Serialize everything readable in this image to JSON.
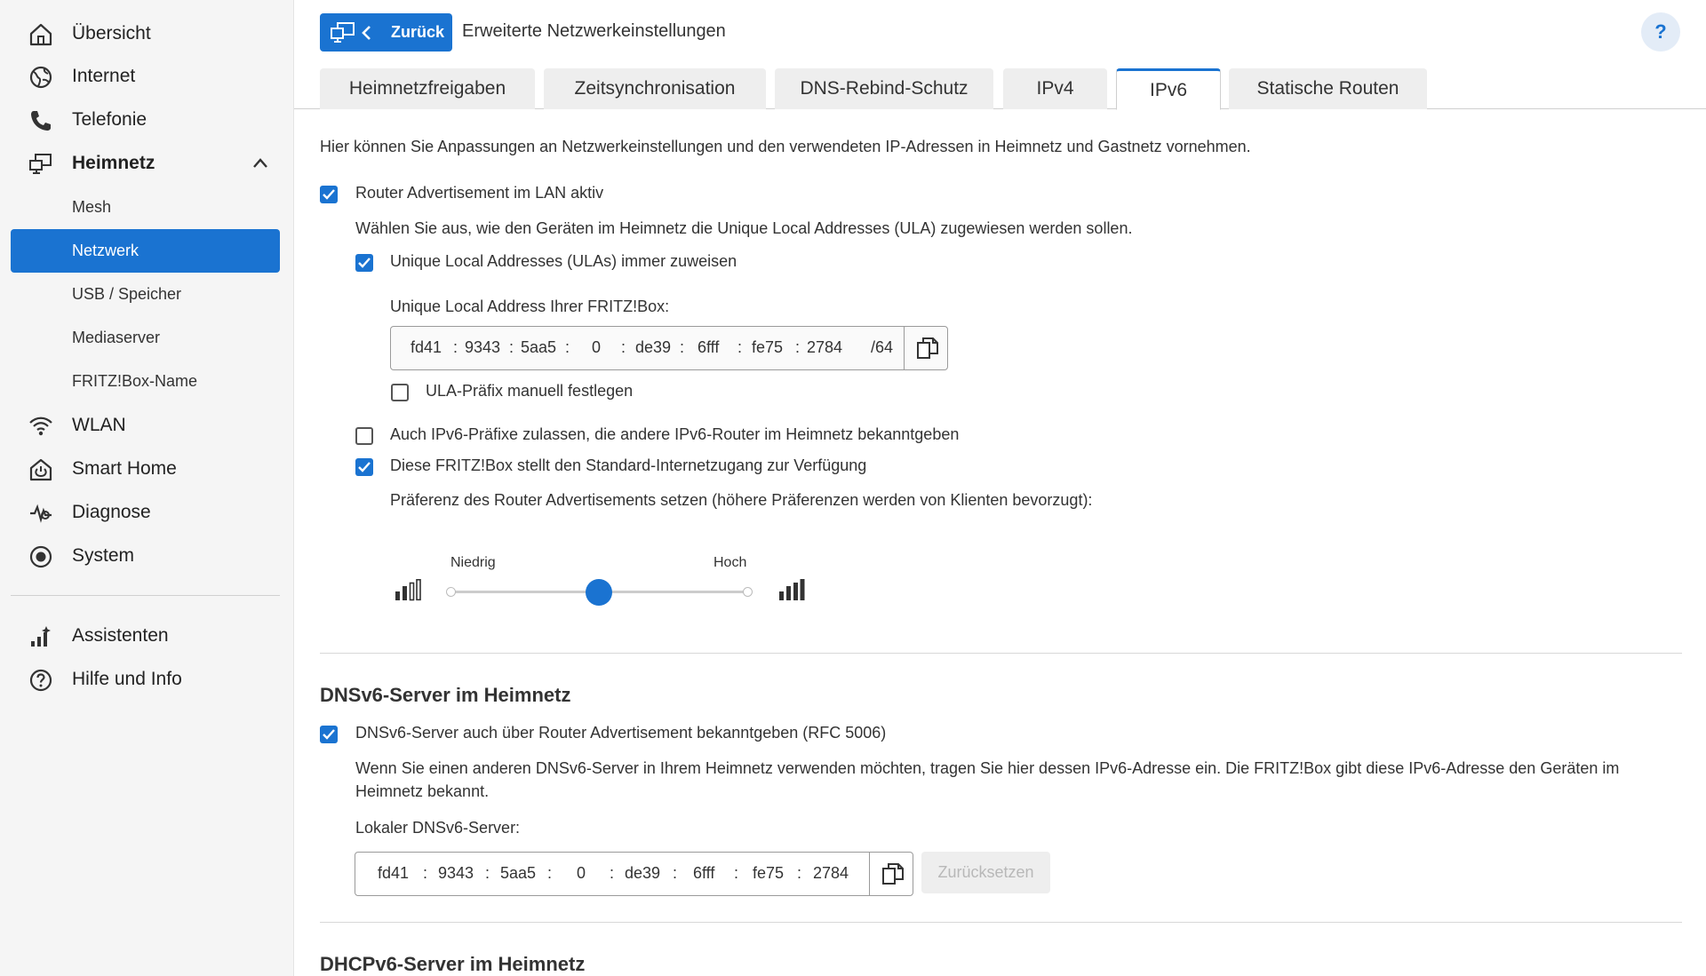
{
  "sidebar": {
    "items": [
      {
        "label": "Übersicht",
        "icon": "home-icon"
      },
      {
        "label": "Internet",
        "icon": "globe-icon"
      },
      {
        "label": "Telefonie",
        "icon": "phone-icon"
      },
      {
        "label": "Heimnetz",
        "icon": "network-icon",
        "expanded": true
      },
      {
        "label": "WLAN",
        "icon": "wifi-icon"
      },
      {
        "label": "Smart Home",
        "icon": "smart-home-icon"
      },
      {
        "label": "Diagnose",
        "icon": "diagnose-icon"
      },
      {
        "label": "System",
        "icon": "system-icon"
      },
      {
        "label": "Assistenten",
        "icon": "assistant-icon"
      },
      {
        "label": "Hilfe und Info",
        "icon": "help-circle-icon"
      }
    ],
    "subitems": [
      {
        "label": "Mesh"
      },
      {
        "label": "Netzwerk",
        "active": true
      },
      {
        "label": "USB / Speicher"
      },
      {
        "label": "Mediaserver"
      },
      {
        "label": "FRITZ!Box-Name"
      }
    ]
  },
  "header": {
    "back_label": "Zurück",
    "title": "Erweiterte Netzwerkeinstellungen",
    "help_label": "?"
  },
  "tabs": [
    {
      "label": "Heimnetzfreigaben"
    },
    {
      "label": "Zeitsynchronisation"
    },
    {
      "label": "DNS-Rebind-Schutz"
    },
    {
      "label": "IPv4"
    },
    {
      "label": "IPv6",
      "active": true
    },
    {
      "label": "Statische Routen"
    }
  ],
  "content": {
    "intro": "Hier können Sie Anpassungen an Netzwerkeinstellungen und den verwendeten IP-Adressen in Heimnetz und Gastnetz vornehmen.",
    "ra_lan": {
      "label": "Router Advertisement im LAN aktiv",
      "checked": true
    },
    "ula_desc": "Wählen Sie aus, wie den Geräten im Heimnetz die Unique Local Addresses (ULA) zugewiesen werden sollen.",
    "ula_always": {
      "label": "Unique Local Addresses (ULAs) immer zuweisen",
      "checked": true
    },
    "ula_addr_label": "Unique Local Address Ihrer FRITZ!Box:",
    "ula_addr": [
      "fd41",
      "9343",
      "5aa5",
      "0",
      "de39",
      "6fff",
      "fe75",
      "2784"
    ],
    "ula_prefix": "/64",
    "ula_manual": {
      "label": "ULA-Präfix manuell festlegen",
      "checked": false
    },
    "other_prefix": {
      "label": "Auch IPv6-Präfixe zulassen, die andere IPv6-Router im Heimnetz bekanntgeben",
      "checked": false
    },
    "std_access": {
      "label": "Diese FRITZ!Box stellt den Standard-Internetzugang zur Verfügung",
      "checked": true
    },
    "pref_label": "Präferenz des Router Advertisements setzen (höhere Präferenzen werden von Klienten bevorzugt):",
    "slider": {
      "low": "Niedrig",
      "high": "Hoch",
      "value": "medium"
    },
    "dns_title": "DNSv6-Server im Heimnetz",
    "dns_ra": {
      "label": "DNSv6-Server auch über Router Advertisement bekanntgeben (RFC 5006)",
      "checked": true
    },
    "dns_desc_1": "Wenn Sie einen anderen DNSv6-Server in Ihrem Heimnetz verwenden möchten, tragen Sie hier dessen IPv6-Adresse ein. Die FRITZ!Box gibt diese IPv6-Adresse den Geräten im",
    "dns_desc_2": "Heimnetz bekannt.",
    "dns_local_label": "Lokaler DNSv6-Server:",
    "dns_addr": [
      "fd41",
      "9343",
      "5aa5",
      "0",
      "de39",
      "6fff",
      "fe75",
      "2784"
    ],
    "reset_label": "Zurücksetzen",
    "dhcp_title": "DHCPv6-Server im Heimnetz"
  },
  "colors": {
    "accent": "#1a73d1",
    "sidebar_bg": "#f5f5f5"
  }
}
